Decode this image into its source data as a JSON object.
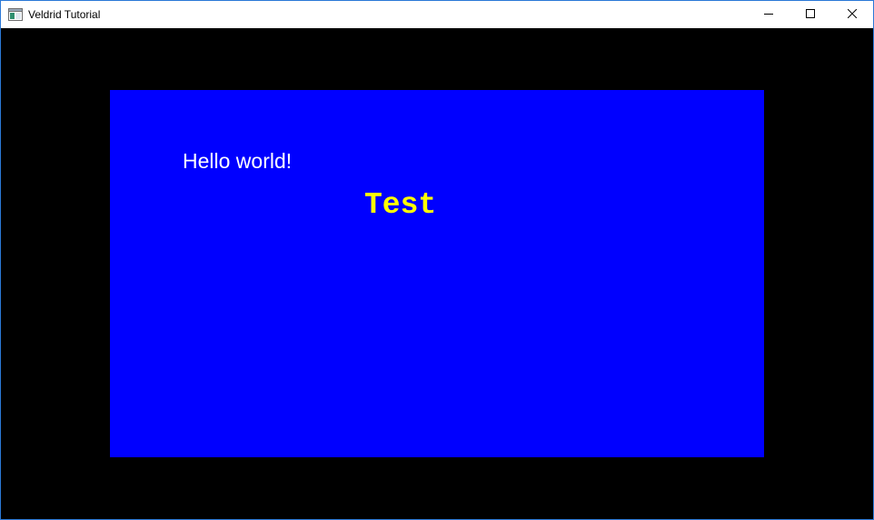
{
  "window": {
    "title": "Veldrid Tutorial",
    "icon": "app-window-icon"
  },
  "controls": {
    "minimize_icon": "minimize-icon",
    "maximize_icon": "maximize-icon",
    "close_icon": "close-icon"
  },
  "scene": {
    "clear_color": "#000000",
    "viewport_color": "#0000ff",
    "hello_text": "Hello world!",
    "hello_color": "#ffffff",
    "test_text": "Test",
    "test_color": "#ffff00"
  }
}
